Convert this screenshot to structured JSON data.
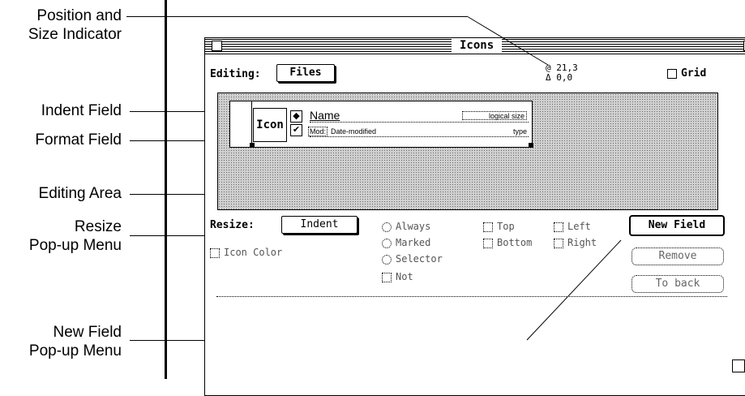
{
  "callouts": {
    "position": [
      "Position and",
      "Size Indicator"
    ],
    "indent_field": "Indent Field",
    "format_field": "Format Field",
    "editing_area": "Editing Area",
    "resize": [
      "Resize",
      "Pop-up Menu"
    ],
    "new_field": [
      "New Field",
      "Pop-up Menu"
    ]
  },
  "window": {
    "title": "Icons",
    "editing_label": "Editing:",
    "editing_value": "Files",
    "position": "@ 21,3",
    "size": "Δ 0,0",
    "grid_label": "Grid"
  },
  "field": {
    "icon_label": "Icon",
    "name": "Name",
    "logical_size": "logical size",
    "mod_label": "Mod:",
    "mod_value": "Date-modified",
    "type": "type"
  },
  "controls": {
    "resize_label": "Resize:",
    "resize_value": "Indent",
    "icon_color": "Icon Color",
    "always": "Always",
    "marked": "Marked",
    "selector": "Selector",
    "not": "Not",
    "top": "Top",
    "bottom": "Bottom",
    "left": "Left",
    "right": "Right",
    "new_field": "New Field",
    "remove": "Remove",
    "to_back": "To back"
  }
}
